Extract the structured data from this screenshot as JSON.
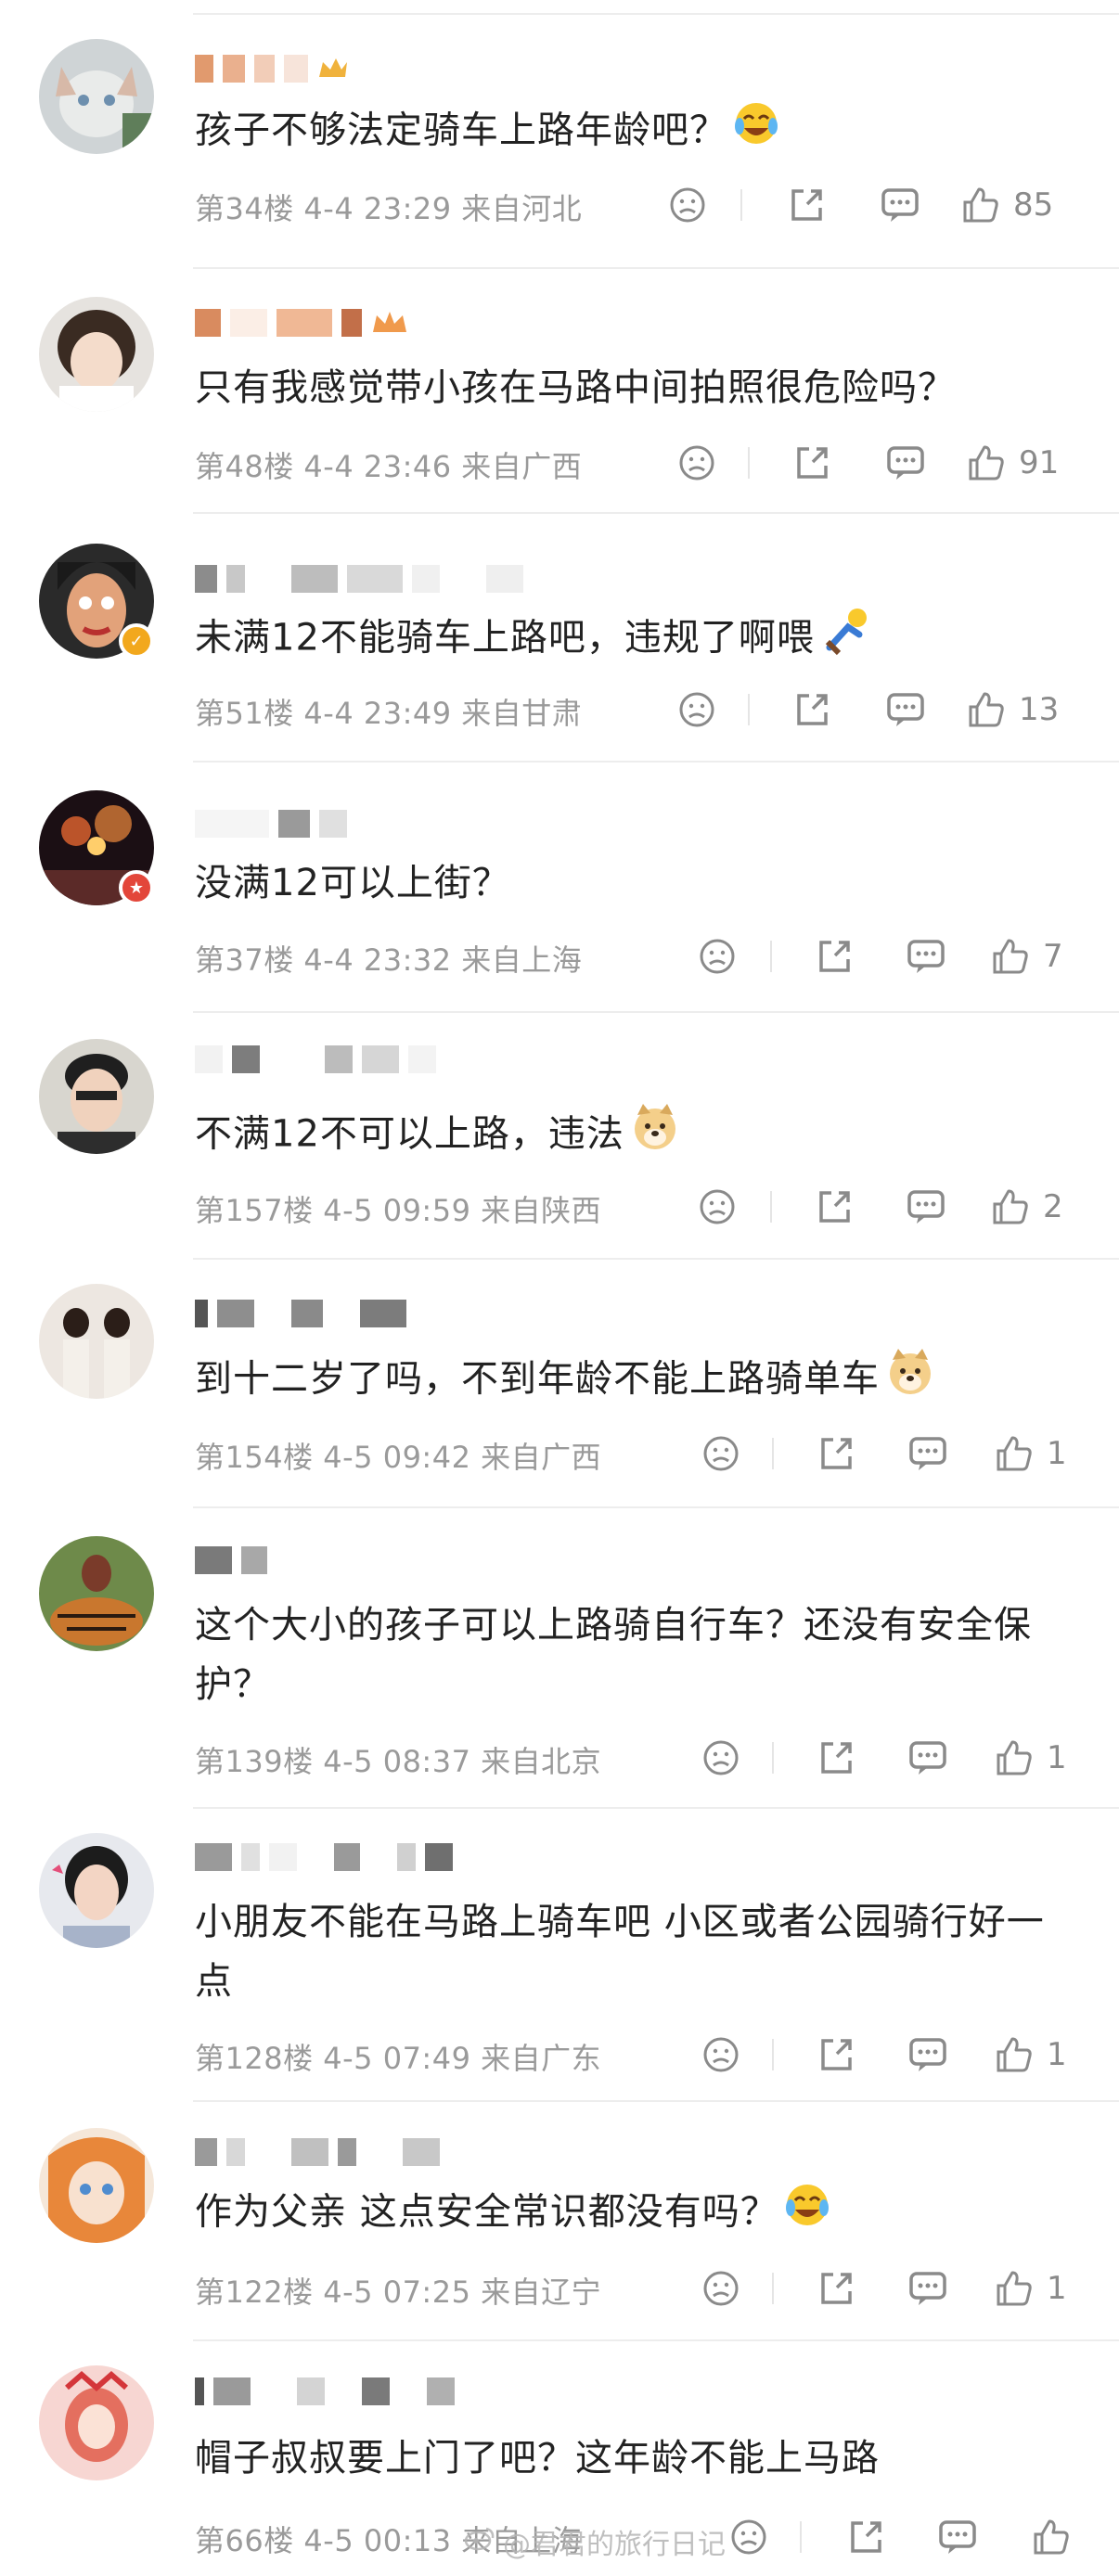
{
  "comments": [
    {
      "text": "孩子不够法定骑车上路年龄吧？",
      "emoji": "laugh-cry-emoji",
      "floor": "第34楼",
      "date": "4-4 23:29",
      "location": "来自河北",
      "likes": "85"
    },
    {
      "text": "只有我感觉带小孩在马路中间拍照很危险吗？",
      "emoji": "",
      "floor": "第48楼",
      "date": "4-4 23:46",
      "location": "来自广西",
      "likes": "91"
    },
    {
      "text": "未满12不能骑车上路吧，违规了啊喂",
      "emoji": "cyclist-emoji",
      "floor": "第51楼",
      "date": "4-4 23:49",
      "location": "来自甘肃",
      "likes": "13"
    },
    {
      "text": "没满12可以上街？",
      "emoji": "",
      "floor": "第37楼",
      "date": "4-4 23:32",
      "location": "来自上海",
      "likes": "7"
    },
    {
      "text": "不满12不可以上路，违法",
      "emoji": "doge-emoji",
      "floor": "第157楼",
      "date": "4-5 09:59",
      "location": "来自陕西",
      "likes": "2"
    },
    {
      "text": "到十二岁了吗，不到年龄不能上路骑单车",
      "emoji": "doge-emoji",
      "floor": "第154楼",
      "date": "4-5 09:42",
      "location": "来自广西",
      "likes": "1"
    },
    {
      "text": "这个大小的孩子可以上路骑自行车？还没有安全保护？",
      "emoji": "",
      "floor": "第139楼",
      "date": "4-5 08:37",
      "location": "来自北京",
      "likes": "1"
    },
    {
      "text": "小朋友不能在马路上骑车吧 小区或者公园骑行好一点",
      "emoji": "",
      "floor": "第128楼",
      "date": "4-5 07:49",
      "location": "来自广东",
      "likes": "1"
    },
    {
      "text": "作为父亲 这点安全常识都没有吗？",
      "emoji": "laugh-cry-emoji",
      "floor": "第122楼",
      "date": "4-5 07:25",
      "location": "来自辽宁",
      "likes": "1"
    },
    {
      "text": "帽子叔叔要上门了吧？这年龄不能上马路",
      "emoji": "",
      "floor": "第66楼",
      "date": "4-5 00:13",
      "location": "来自上海",
      "likes": ""
    }
  ],
  "watermark": "@君君的旅行日记",
  "colors": {
    "text": "#222222",
    "meta": "#9a9a9a",
    "divider": "#ededed",
    "icon": "#8a8a8a"
  }
}
